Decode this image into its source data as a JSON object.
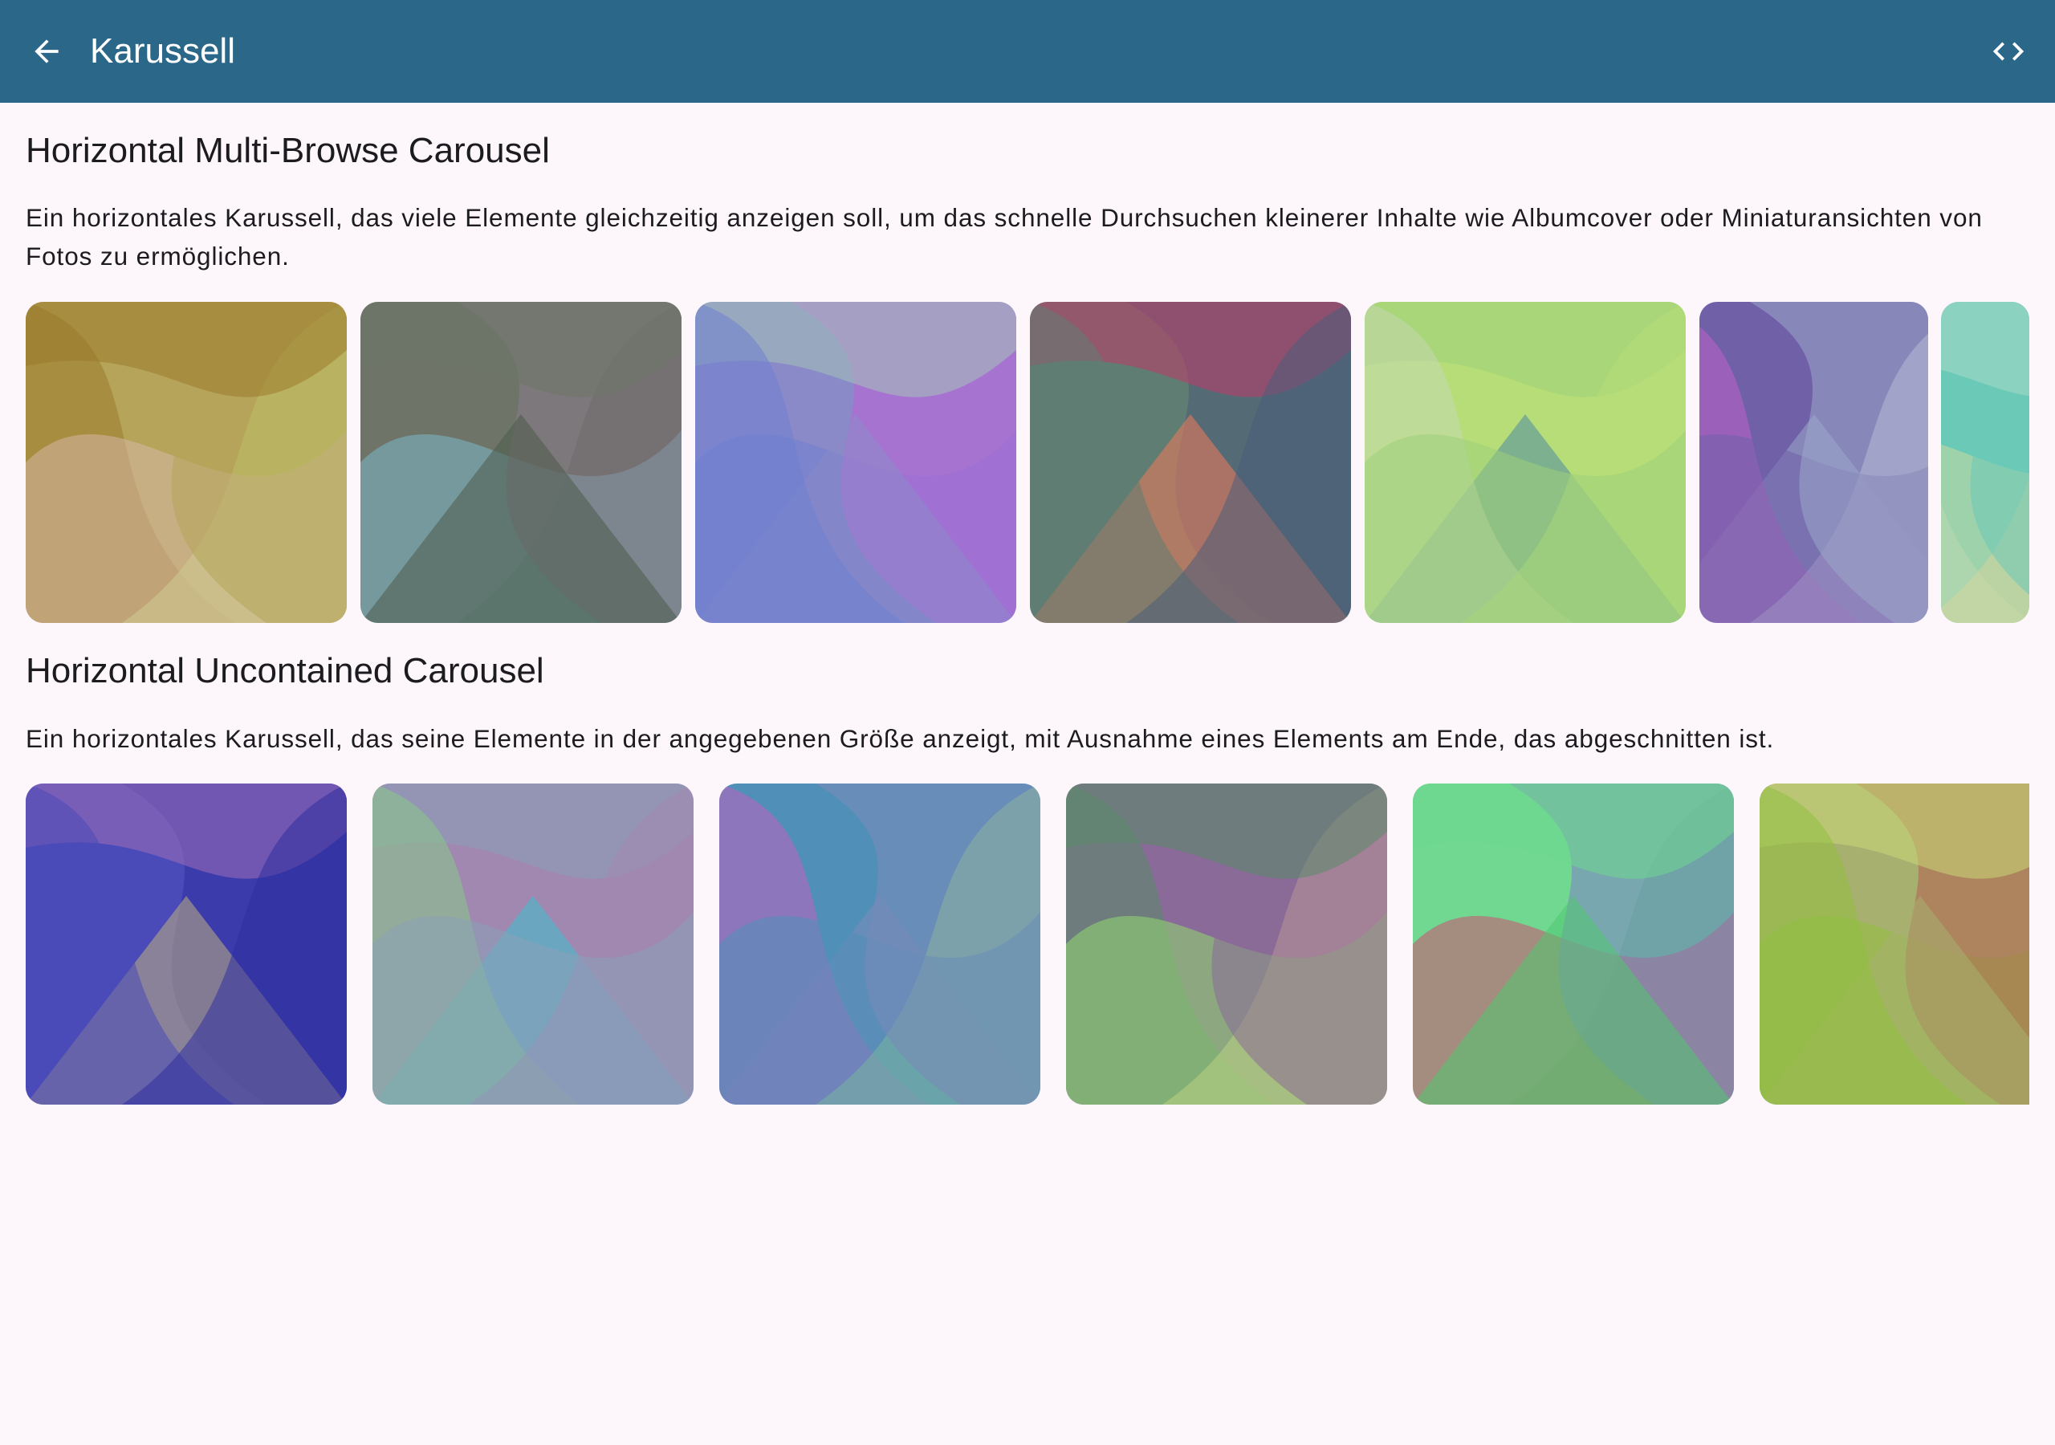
{
  "app_bar": {
    "title": "Karussell",
    "back_icon": "arrow-back-icon",
    "code_icon": "code-icon",
    "background_color": "#2b6789"
  },
  "sections": [
    {
      "title": "Horizontal Multi-Browse Carousel",
      "description": "Ein horizontales Karussell, das viele Elemente gleichzeitig anzeigen soll, um das schnelle Durchsuchen kleinerer Inhalte wie Albumcover oder Miniaturansichten von Fotos zu ermöglichen.",
      "items": [
        {
          "colors": [
            "#b5a45a",
            "#9a7a2c",
            "#c7e27a",
            "#d6b8a5"
          ]
        },
        {
          "colors": [
            "#6e7568",
            "#4c5b4a",
            "#7eb6c9",
            "#8a7a8a"
          ]
        },
        {
          "colors": [
            "#8a8ac8",
            "#6f7fcf",
            "#c060d8",
            "#a4c3b8"
          ]
        },
        {
          "colors": [
            "#5f7d72",
            "#4a5d7a",
            "#c03a6a",
            "#f07a5a"
          ]
        },
        {
          "colors": [
            "#b7dd78",
            "#9ccf7a",
            "#4e8aa0",
            "#c4d9b0"
          ]
        },
        {
          "colors": [
            "#6f60a8",
            "#9aa8c8",
            "#c060c8",
            "#d8d0e8"
          ]
        },
        {
          "colors": [
            "#6bc9b8",
            "#a8d8c8",
            "#e0d098",
            "#c8d8a0"
          ]
        }
      ]
    },
    {
      "title": "Horizontal Uncontained Carousel",
      "description": "Ein horizontales Karussell, das seine Elemente in der angegebenen Größe anzeigt, mit Ausnahme eines Elements am Ende, das abgeschnitten ist.",
      "items": [
        {
          "colors": [
            "#4a4ab8",
            "#3030a0",
            "#a070b8",
            "#c0b080"
          ]
        },
        {
          "colors": [
            "#a088b0",
            "#8aa0b8",
            "#40c0d0",
            "#88c888"
          ]
        },
        {
          "colors": [
            "#5090b8",
            "#7a8ab8",
            "#c060c0",
            "#a8e080"
          ]
        },
        {
          "colors": [
            "#8a6a98",
            "#5a8a6a",
            "#f0c898",
            "#90d870"
          ]
        },
        {
          "colors": [
            "#70d890",
            "#50c870",
            "#d05070",
            "#8080c8"
          ]
        },
        {
          "colors": [
            "#a8b070",
            "#90c040",
            "#b06050",
            "#c8d878"
          ]
        }
      ]
    }
  ]
}
